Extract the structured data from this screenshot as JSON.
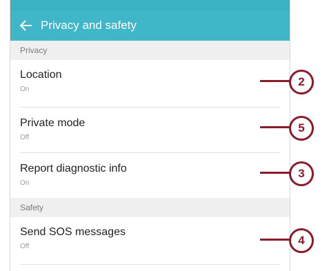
{
  "header": {
    "title": "Privacy and safety",
    "back_icon": "back-arrow-icon"
  },
  "sections": [
    {
      "label": "Privacy"
    },
    {
      "label": "Safety"
    }
  ],
  "items": [
    {
      "title": "Location",
      "status": "On"
    },
    {
      "title": "Private mode",
      "status": "Off"
    },
    {
      "title": "Report diagnostic info",
      "status": "On"
    },
    {
      "title": "Send SOS messages",
      "status": "Off"
    }
  ],
  "callouts": [
    "2",
    "5",
    "3",
    "4"
  ],
  "colors": {
    "appbar": "#3fb7c8",
    "callout": "#8b1a2b"
  }
}
